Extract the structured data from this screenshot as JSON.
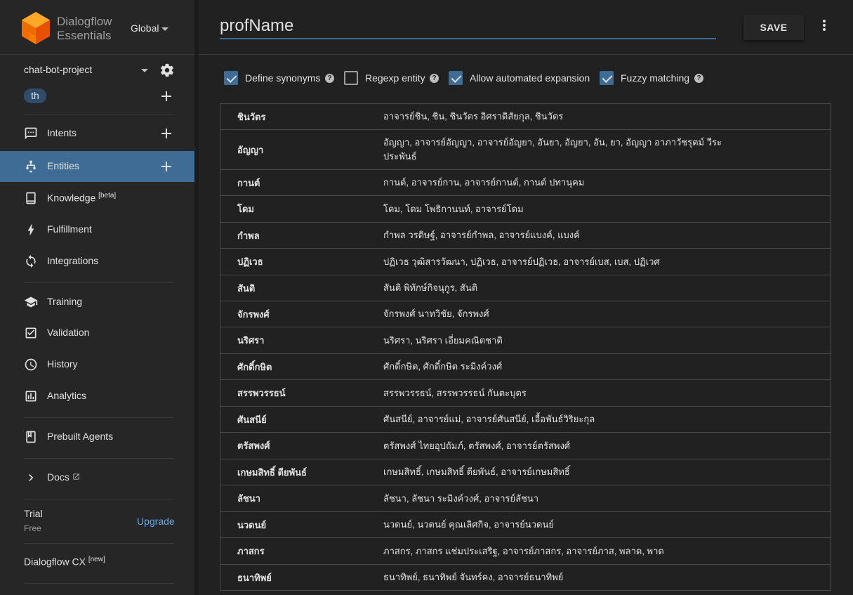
{
  "brand": {
    "line1": "Dialogflow",
    "line2": "Essentials",
    "region": "Global"
  },
  "project": {
    "name": "chat-bot-project",
    "language": "th"
  },
  "nav": {
    "intents": "Intents",
    "entities": "Entities",
    "knowledge": "Knowledge",
    "knowledge_tag": "[beta]",
    "fulfillment": "Fulfillment",
    "integrations": "Integrations",
    "training": "Training",
    "validation": "Validation",
    "history": "History",
    "analytics": "Analytics",
    "prebuilt": "Prebuilt Agents",
    "docs": "Docs"
  },
  "trial": {
    "label": "Trial",
    "sub": "Free",
    "upgrade": "Upgrade"
  },
  "cx": {
    "label": "Dialogflow CX",
    "tag": "[new]"
  },
  "header": {
    "entity_name": "profName",
    "save": "SAVE"
  },
  "options": [
    {
      "label": "Define synonyms",
      "checked": true,
      "help": "?"
    },
    {
      "label": "Regexp entity",
      "checked": false,
      "help": "?"
    },
    {
      "label": "Allow automated expansion",
      "checked": true
    },
    {
      "label": "Fuzzy matching",
      "checked": true,
      "help": "?"
    }
  ],
  "entries": [
    {
      "ref": "ชินวัตร",
      "syn": "อาจารย์ชิน, ชิน, ชินวัตร อิศราดิสัยกุล, ชินวัตร"
    },
    {
      "ref": "อัญญา",
      "syn": "อัญญา, อาจารย์อัญญา, อาจารย์อัญยา, อันยา, อัญยา, อัน, ยา, อัญญา อาภาวัชรุตม์ วีระประพันธ์"
    },
    {
      "ref": "กานต์",
      "syn": "กานต์, อาจารย์กาน, อาจารย์กานต์, กานต์ ปทานุคม"
    },
    {
      "ref": "โดม",
      "syn": "โดม, โดม โพธิกานนท์, อาจารย์โดม"
    },
    {
      "ref": "กำพล",
      "syn": "กำพล วรดิษฐ์, อาจารย์กำพล, อาจารย์แบงค์, แบงค์"
    },
    {
      "ref": "ปฏิเวธ",
      "syn": "ปฏิเวธ วุฒิสารวัฒนา, ปฏิเวธ, อาจารย์ปฏิเวธ, อาจารย์เบส, เบส, ปฏิเวศ"
    },
    {
      "ref": "สันติ",
      "syn": "สันติ พิทักษ์กิจนุกูร, สันติ"
    },
    {
      "ref": "จักรพงศ์",
      "syn": "จักรพงศ์ นาทวิชัย, จักรพงศ์"
    },
    {
      "ref": "นริศรา",
      "syn": "นริศรา, นริศรา เอี่ยมคณิตชาติ"
    },
    {
      "ref": "ศักดิ์กษิต",
      "syn": "ศักดิ์กษิต, ศักดิ์กษิต ระมิงค์วงศ์"
    },
    {
      "ref": "สรรพวรรธน์",
      "syn": "สรรพวรรธน์, สรรพวรรธน์ กันตะบุตร"
    },
    {
      "ref": "ศันสนีย์",
      "syn": "ศันสนีย์, อาจารย์แม่, อาจารย์ศันสนีย์, เอื้อพันธ์วิริยะกุล"
    },
    {
      "ref": "ตรัสพงศ์",
      "syn": "ตรัสพงศ์ ไทยอุปถัมภ์, ตรัสพงศ์, อาจารย์ตรัสพงศ์"
    },
    {
      "ref": "เกษมสิทธิ์ ตียพันธ์",
      "syn": "เกษมสิทธิ์, เกษมสิทธิ์ ตียพันธ์, อาจารย์เกษมสิทธิ์"
    },
    {
      "ref": "ลัชนา",
      "syn": "ลัชนา, ลัชนา ระมิงค์วงศ์, อาจารย์ลัชนา"
    },
    {
      "ref": "นวดนย์",
      "syn": "นวดนย์, นวดนย์ คุณเลิศกิจ, อาจารย์นวดนย์"
    },
    {
      "ref": "ภาสกร",
      "syn": "ภาสกร, ภาสกร แช่มประเสริฐ, อาจารย์ภาสกร, อาจารย์ภาส, พลาด, พาด"
    },
    {
      "ref": "ธนาทิพย์",
      "syn": "ธนาทิพย์, ธนาทิพย์ จันทร์คง, อาจารย์ธนาทิพย์"
    }
  ],
  "colors": {
    "accent": "#3e6c95",
    "link": "#64a8e6",
    "bg": "#212121",
    "sidebar": "#262626"
  }
}
